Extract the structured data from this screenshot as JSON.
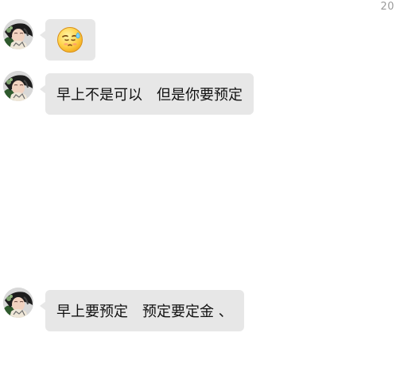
{
  "header": {
    "timestamp": "20"
  },
  "messages": [
    {
      "id": "m1",
      "type": "emoji",
      "icon": "embarrassed-sweat-face-emoji"
    },
    {
      "id": "m2",
      "type": "text",
      "text": "早上不是可以　但是你要预定"
    },
    {
      "id": "m3",
      "type": "text",
      "text": "早上要预定　预定要定金 、"
    }
  ],
  "avatar": {
    "icon": "contact-avatar-photo"
  }
}
